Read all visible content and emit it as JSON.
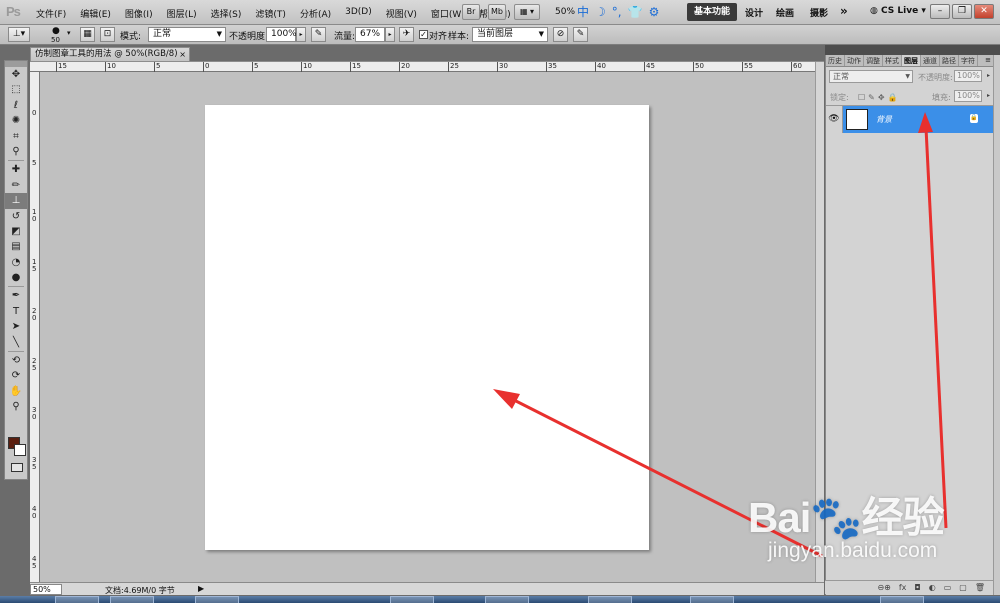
{
  "app": {
    "logo_text": "Ps",
    "menu": [
      "文件(F)",
      "编辑(E)",
      "图像(I)",
      "图层(L)",
      "选择(S)",
      "滤镜(T)",
      "分析(A)",
      "3D(D)",
      "视图(V)",
      "窗口(W)",
      "帮助(H)"
    ],
    "bridge_label": "Br",
    "minibridge_label": "Mb",
    "zoom": "50%",
    "workspaces": [
      "基本功能",
      "设计",
      "绘画",
      "摄影"
    ],
    "more_label": "»",
    "cs_live": "CS Live",
    "ime_glyphs": [
      "中",
      "☽",
      "°,",
      "👕",
      "⚙"
    ]
  },
  "options": {
    "brush_size": "50",
    "mode_label": "模式:",
    "mode_value": "正常",
    "opacity_label": "不透明度:",
    "opacity_value": "100%",
    "flow_label": "流量:",
    "flow_value": "67%",
    "align_label": "对齐",
    "align_checked": "✓",
    "sample_label": "样本:",
    "sample_value": "当前图层"
  },
  "document": {
    "tab_title": "仿制图章工具的用法 @ 50%(RGB/8)",
    "close": "×",
    "ruler_h_labels": [
      "15",
      "10",
      "5",
      "0",
      "5",
      "10",
      "15",
      "20",
      "25",
      "30",
      "35",
      "40",
      "45",
      "50",
      "55",
      "60",
      "65"
    ],
    "ruler_v_labels": [
      "0",
      "5",
      "1",
      "1",
      "2",
      "2",
      "3",
      "3",
      "4",
      "4"
    ],
    "ruler_v_sub": [
      "",
      "",
      "0",
      "5",
      "0",
      "5",
      "0",
      "5",
      "0",
      "5"
    ]
  },
  "status": {
    "zoom": "50%",
    "doc_info": "文档:4.69M/0 字节",
    "arrow": "▶"
  },
  "panel": {
    "tabs": [
      "历史",
      "动作",
      "调整",
      "样式",
      "图层",
      "通道",
      "路径",
      "字符"
    ],
    "active_tab": "图层",
    "blend_mode": "正常",
    "opacity_label": "不透明度:",
    "opacity_value": "100%",
    "lock_label": "锁定:",
    "fill_label": "填充:",
    "fill_value": "100%",
    "layer_name": "背景",
    "bottom_icons": [
      "⊖⊕",
      "fx",
      "◘",
      "◐",
      "▭",
      "▢",
      "🗑"
    ]
  },
  "watermark": {
    "main": "Bai🐾经验",
    "sub": "jingyan.baidu.com"
  },
  "colors": {
    "accent_layer": "#3b8fe8",
    "arrow_red": "#e8302e",
    "foreground": "#5a1f10",
    "background": "#ffffff"
  }
}
